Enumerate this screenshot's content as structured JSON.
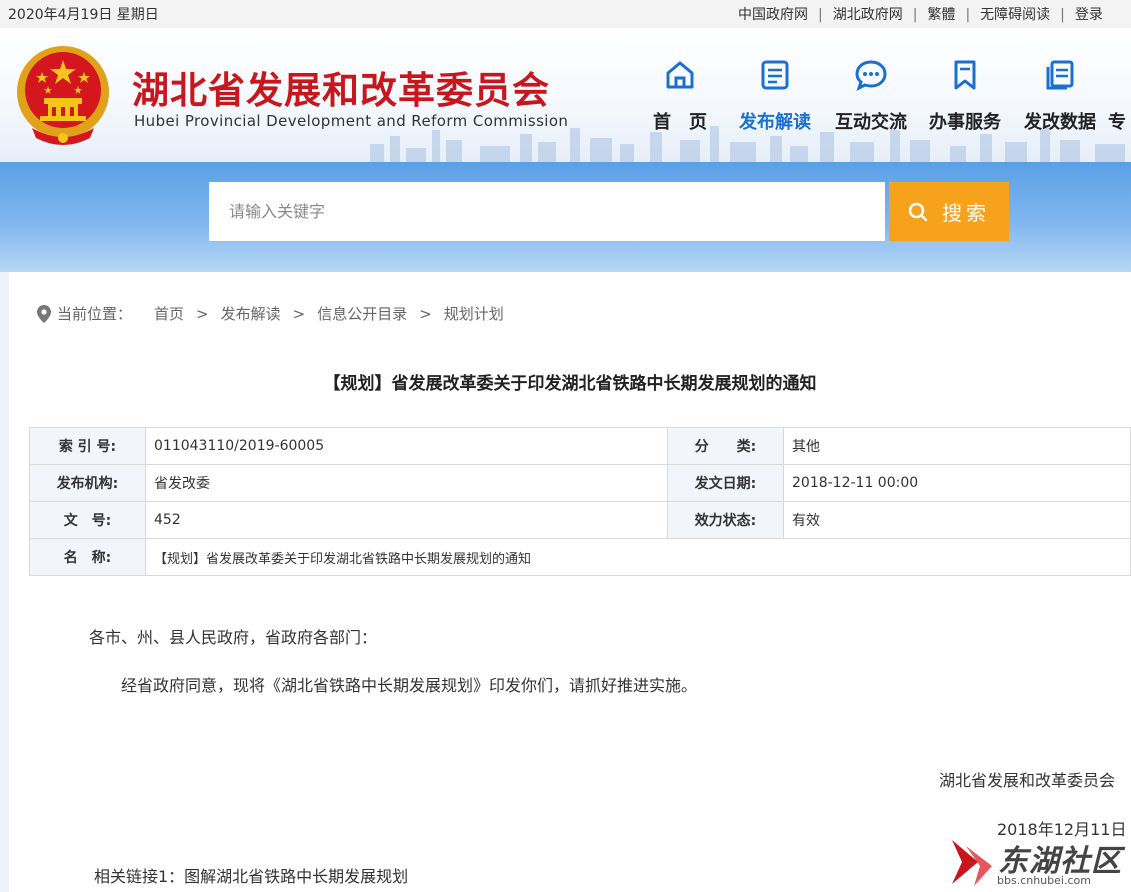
{
  "topbar": {
    "date": "2020年4月19日 星期日",
    "links": [
      "中国政府网",
      "湖北政府网",
      "繁體",
      "无障碍阅读",
      "登录"
    ]
  },
  "header": {
    "title_cn": "湖北省发展和改革委员会",
    "title_en": "Hubei Provincial Development and Reform Commission",
    "nav": [
      {
        "label": "首　页",
        "icon": "home-icon"
      },
      {
        "label": "发布解读",
        "icon": "document-icon",
        "active": true
      },
      {
        "label": "互动交流",
        "icon": "chat-icon"
      },
      {
        "label": "办事服务",
        "icon": "bookmark-icon"
      },
      {
        "label": "发改数据",
        "icon": "data-copy-icon"
      },
      {
        "label": "专",
        "icon": ""
      }
    ]
  },
  "search": {
    "placeholder": "请输入关键字",
    "button_label": "搜索"
  },
  "breadcrumb": {
    "label": "当前位置：",
    "items": [
      "首页",
      "发布解读",
      "信息公开目录",
      "规划计划"
    ]
  },
  "document": {
    "title": "【规划】省发展改革委关于印发湖北省铁路中长期发展规划的通知",
    "meta": {
      "index_label": "索 引 号:",
      "index_value": "011043110/2019-60005",
      "category_label": "分　　类:",
      "category_value": "其他",
      "issuer_label": "发布机构:",
      "issuer_value": "省发改委",
      "date_label": "发文日期:",
      "date_value": "2018-12-11 00:00",
      "docno_label": "文　号:",
      "docno_value": "452",
      "status_label": "效力状态:",
      "status_value": "有效",
      "name_label": "名　称:",
      "name_value": "【规划】省发展改革委关于印发湖北省铁路中长期发展规划的通知"
    },
    "salutation": "各市、州、县人民政府，省政府各部门：",
    "body": "经省政府同意，现将《湖北省铁路中长期发展规划》印发你们，请抓好推进实施。",
    "signer": "湖北省发展和改革委员会",
    "sign_date": "2018年12月11日",
    "related_link": "相关链接1：图解湖北省铁路中长期发展规划"
  },
  "watermark": {
    "text": "东湖社区",
    "url": "bbs.cnhubei.com"
  },
  "colors": {
    "brand_red": "#c8161d",
    "accent_blue": "#1a6fd0",
    "search_orange": "#f7a21b"
  }
}
